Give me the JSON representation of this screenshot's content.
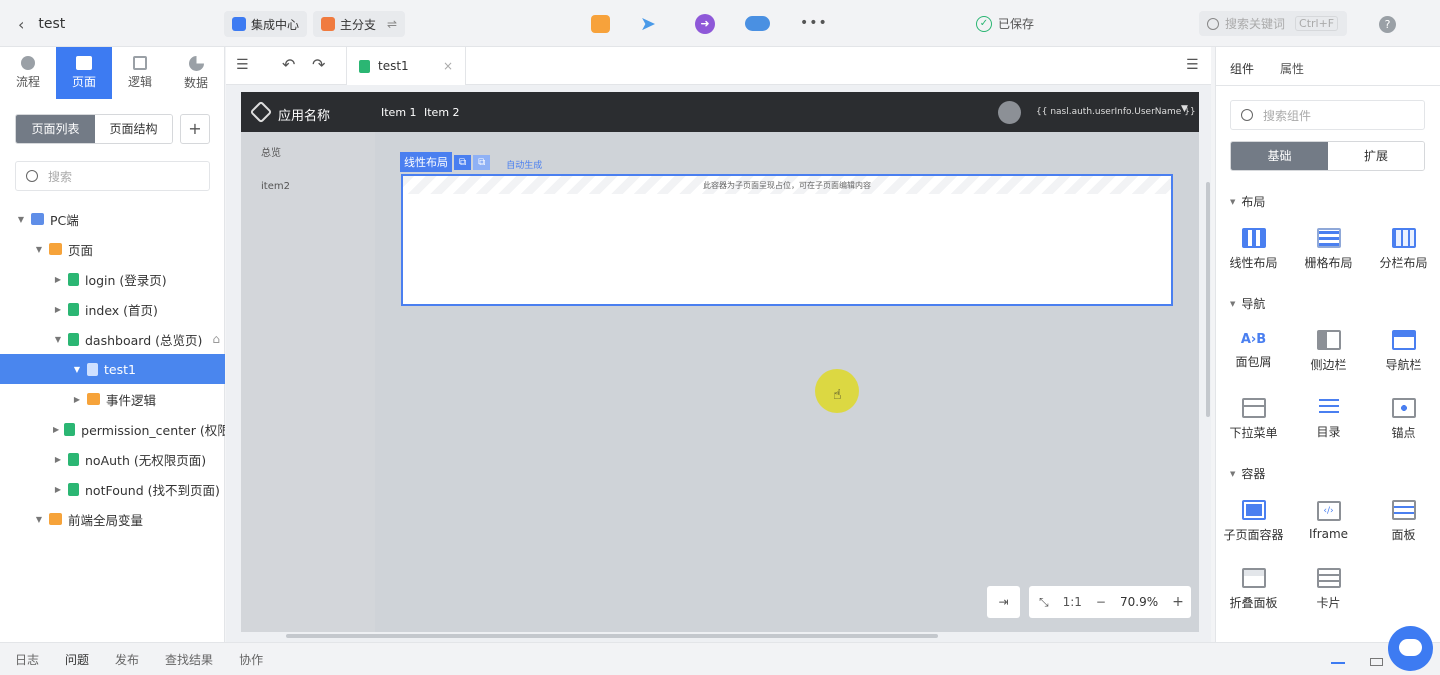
{
  "topbar": {
    "project_title": "test",
    "integration_label": "集成中心",
    "branch_label": "主分支",
    "saved_label": "已保存",
    "search_placeholder": "搜索关键词",
    "search_shortcut": "Ctrl+F",
    "more_label": "•••",
    "help_label": "?"
  },
  "left": {
    "tabs": [
      {
        "label": "流程"
      },
      {
        "label": "页面"
      },
      {
        "label": "逻辑"
      },
      {
        "label": "数据"
      }
    ],
    "page_list_label": "页面列表",
    "page_structure_label": "页面结构",
    "add_label": "+",
    "search_placeholder": "搜索",
    "tree": [
      {
        "label": "PC端"
      },
      {
        "label": "页面"
      },
      {
        "label": "login (登录页)"
      },
      {
        "label": "index (首页)"
      },
      {
        "label": "dashboard (总览页)"
      },
      {
        "label": "test1"
      },
      {
        "label": "事件逻辑"
      },
      {
        "label": "permission_center (权限中"
      },
      {
        "label": "noAuth (无权限页面)"
      },
      {
        "label": "notFound (找不到页面)"
      },
      {
        "label": "前端全局变量"
      }
    ]
  },
  "editor": {
    "tab_label": "test1",
    "tab_close": "×",
    "app_name": "应用名称",
    "nav_items": [
      "Item 1",
      "Item 2"
    ],
    "user_expr": "{{ nasl.auth.userInfo.UserName }}",
    "side_items": [
      "总览",
      "item2"
    ],
    "linear_label": "线性布局",
    "auto_gen_label": "自动生成",
    "container_hint": "此容器为子页面呈现占位，可在子页面编辑内容",
    "ratio_label": "1:1",
    "zoom_label": "70.9%",
    "zoom_minus": "−",
    "zoom_plus": "+"
  },
  "right": {
    "tabs": [
      "组件",
      "属性"
    ],
    "search_placeholder": "搜索组件",
    "basic_label": "基础",
    "extend_label": "扩展",
    "sections": [
      {
        "title": "布局",
        "items": [
          "线性布局",
          "栅格布局",
          "分栏布局"
        ]
      },
      {
        "title": "导航",
        "items": [
          "面包屑",
          "侧边栏",
          "导航栏",
          "下拉菜单",
          "目录",
          "锚点"
        ]
      },
      {
        "title": "容器",
        "items": [
          "子页面容器",
          "Iframe",
          "面板",
          "折叠面板",
          "卡片"
        ]
      }
    ]
  },
  "bottom": {
    "tabs": [
      "日志",
      "问题",
      "发布",
      "查找结果",
      "协作"
    ]
  },
  "colors": {
    "accent": "#3d7bf2",
    "selected_row": "#4a86ee",
    "app_header": "#2b2d30",
    "success": "#2bb673",
    "folder": "#f6a33a"
  }
}
